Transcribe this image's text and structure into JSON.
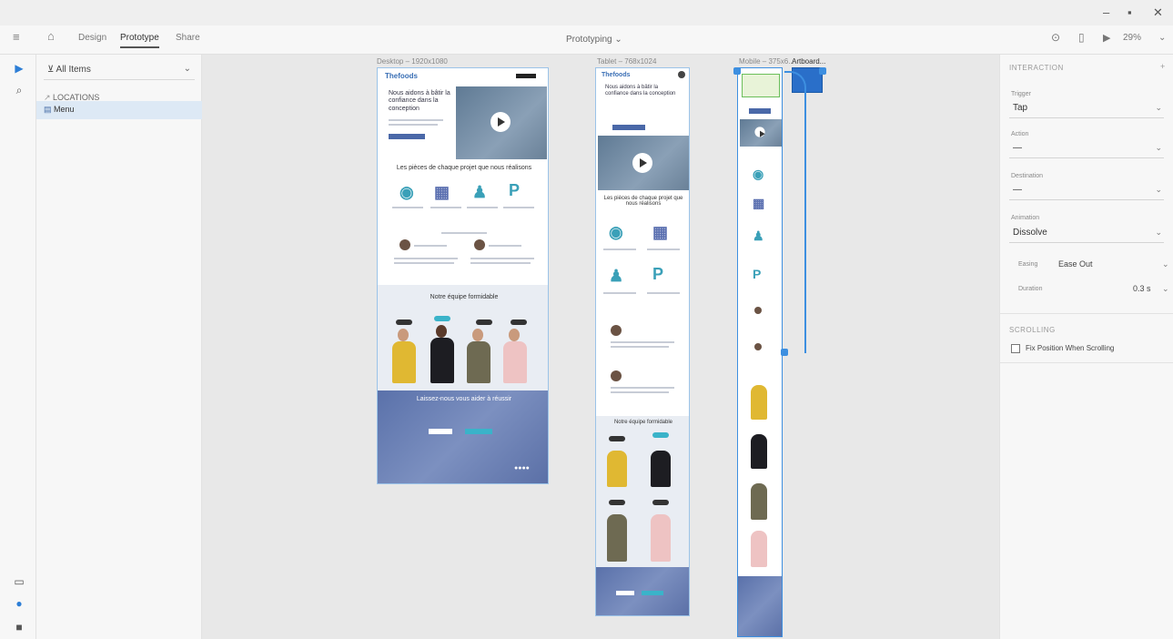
{
  "titlebar": {
    "watermark": "",
    "minimize": "–",
    "restore": "▪",
    "close": "✕"
  },
  "toolbar": {
    "menu_icon": "hamburger-menu-icon",
    "home_icon": "home-icon",
    "tabs": [
      "Design",
      "Prototype",
      "Share"
    ],
    "active_tab": "Prototype",
    "document_title": "Prototyping ⌄",
    "zoom": "29%"
  },
  "layers": {
    "filter_label": "All Items",
    "items": [
      {
        "label": "LOCATIONS",
        "selected": false
      },
      {
        "label": "Menu",
        "selected": true
      }
    ]
  },
  "canvas": {
    "artboards": [
      {
        "label": "Desktop – 1920x1080"
      },
      {
        "label": "Tablet – 768x1024"
      },
      {
        "label": "Mobile – 375x6..."
      },
      {
        "label": "Artboard..."
      }
    ],
    "desktop": {
      "logo": "Thefoods",
      "hero_text": "Nous aidons à bâtir la confiance dans la conception",
      "section_title": "Les pièces de chaque projet que nous réalisons",
      "team_title": "Notre équipe formidable",
      "cta_title": "Laissez-nous vous aider à réussir"
    },
    "tablet": {
      "logo": "Thefoods",
      "hero_text": "Nous aidons à bâtir la confiance dans la conception",
      "section_title": "Les pièces de chaque projet que nous réalisons",
      "team_title": "Notre équipe formidable"
    }
  },
  "props": {
    "section_interaction": "INTERACTION",
    "trigger_label": "Trigger",
    "trigger_value": "Tap",
    "action_label": "Action",
    "action_value": "—",
    "destination_label": "Destination",
    "destination_value": "—",
    "animation_label": "Animation",
    "animation_value": "Dissolve",
    "easing_label": "Easing",
    "easing_value": "Ease Out",
    "duration_label": "Duration",
    "duration_value": "0.3 s",
    "section_scrolling": "SCROLLING",
    "fix_position_label": "Fix Position When Scrolling"
  },
  "colors": {
    "accent": "#3d8fe0",
    "brand_blue": "#4a68a8",
    "teal": "#3aa0b8"
  }
}
